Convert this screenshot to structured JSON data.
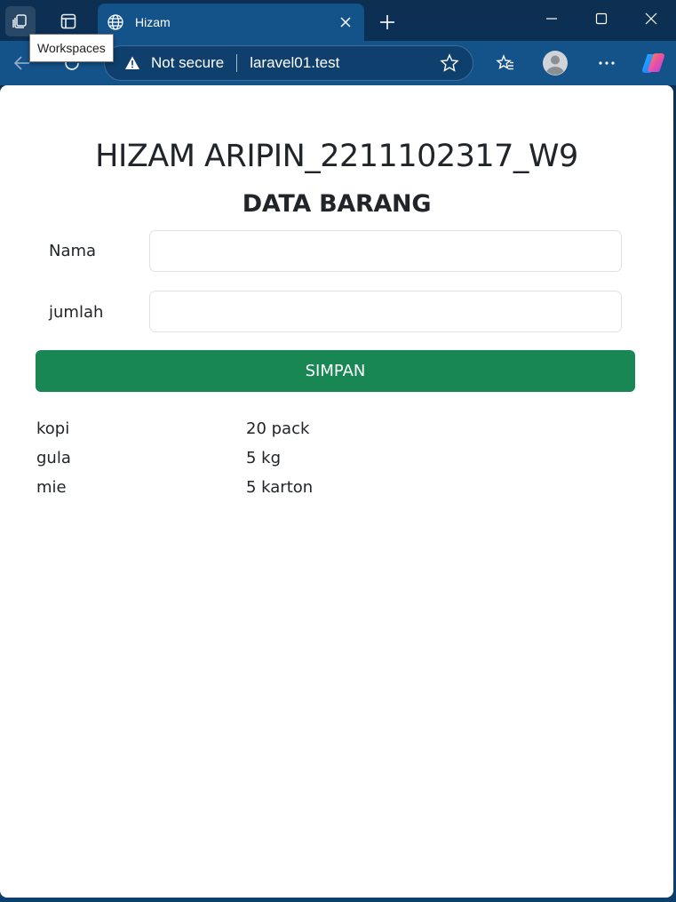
{
  "browser": {
    "tooltip": "Workspaces",
    "tab": {
      "title": "Hizam",
      "favicon": "globe-icon"
    },
    "address": {
      "security_label": "Not secure",
      "url": "laravel01.test"
    },
    "icons": {
      "workspaces": "workspaces-icon",
      "tab_actions": "tab-actions-icon",
      "new_tab": "plus-icon",
      "back": "back-arrow-icon",
      "refresh": "refresh-icon",
      "favorite": "star-icon",
      "favorites": "favorites-icon",
      "profile": "profile-icon",
      "more": "more-icon",
      "copilot": "copilot-icon"
    },
    "colors": {
      "frame": "#0c2f52",
      "toolbar": "#14528a"
    }
  },
  "page": {
    "title": "HIZAM ARIPIN_2211102317_W9",
    "subtitle": "DATA BARANG",
    "form": {
      "nama_label": "Nama",
      "nama_value": "",
      "jumlah_label": "jumlah",
      "jumlah_value": "",
      "submit_label": "SIMPAN"
    },
    "items": [
      {
        "name": "kopi",
        "qty": "20 pack"
      },
      {
        "name": "gula",
        "qty": "5 kg"
      },
      {
        "name": "mie",
        "qty": "5 karton"
      }
    ],
    "colors": {
      "button": "#198754",
      "text": "#212529"
    }
  }
}
